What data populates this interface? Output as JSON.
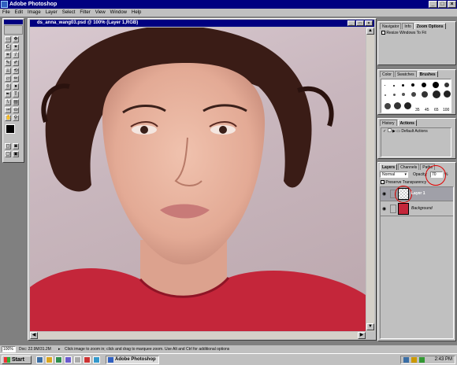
{
  "app": {
    "title": "Adobe Photoshop"
  },
  "menu": [
    "File",
    "Edit",
    "Image",
    "Layer",
    "Select",
    "Filter",
    "View",
    "Window",
    "Help"
  ],
  "document": {
    "title": "ds_anna_wang03.psd @ 100% (Layer 1,RGB)"
  },
  "navigator_panel": {
    "tabs": [
      "Navigator",
      "Info",
      "Zoom Options"
    ],
    "checkbox_label": "Resize Windows To Fit"
  },
  "brushes_panel": {
    "tabs": [
      "Color",
      "Swatches",
      "Brushes"
    ],
    "sizes": [
      "35",
      "45",
      "65",
      "100"
    ]
  },
  "actions_panel": {
    "tabs": [
      "History",
      "Actions"
    ],
    "item": "Default Actions"
  },
  "layers_panel": {
    "tabs": [
      "Layers",
      "Channels",
      "Paths"
    ],
    "blend_mode": "Normal",
    "opacity_label": "Opacity:",
    "opacity_value": "70",
    "opacity_unit": "%",
    "preserve_label": "Preserve Transparency",
    "layers": [
      {
        "name": "Layer 1"
      },
      {
        "name": "Background"
      }
    ]
  },
  "status": {
    "zoom": "100%",
    "doc_size": "Doc: 22.9M/31.2M",
    "hint": "Click image to zoom in; click and drag to marquee zoom. Use Alt and Ctrl for additional options"
  },
  "taskbar": {
    "start": "Start",
    "task": "Adobe Photoshop",
    "clock": "2:43 PM"
  },
  "colors": {
    "titlebar": "#000080",
    "chrome": "#c0c0c0",
    "sweater": "#c4263a",
    "highlight_circle": "#e00000"
  }
}
